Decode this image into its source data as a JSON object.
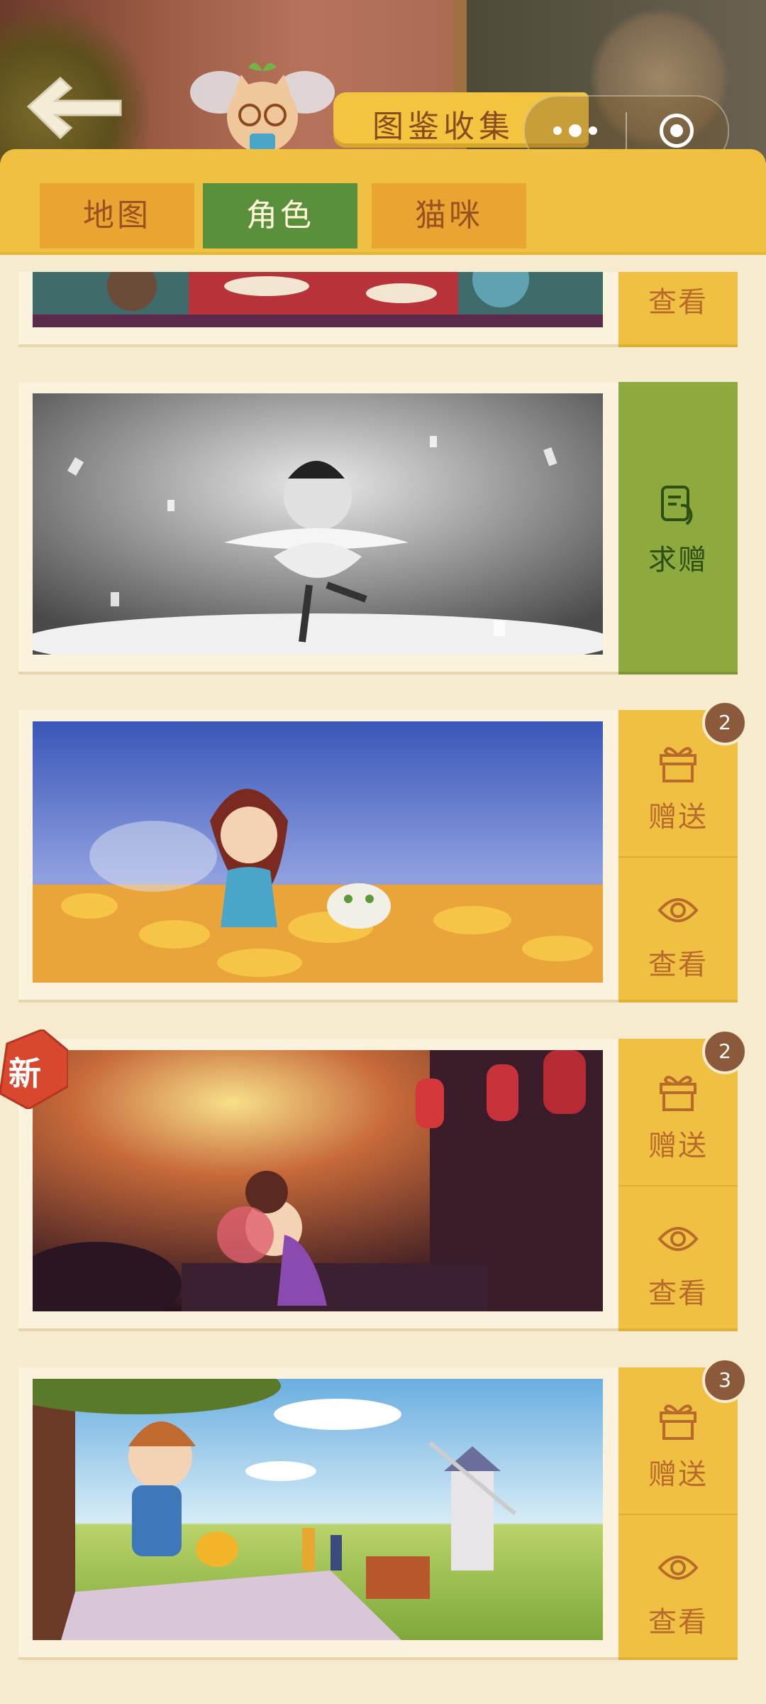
{
  "header": {
    "title": "图鉴收集"
  },
  "tabs": [
    {
      "label": "地图",
      "active": false
    },
    {
      "label": "角色",
      "active": true
    },
    {
      "label": "猫咪",
      "active": false
    }
  ],
  "cards": [
    {
      "id": "partial",
      "actions": [
        {
          "label": "查看",
          "icon": "eye-icon"
        }
      ]
    },
    {
      "id": "ballerina",
      "actions": [
        {
          "label": "求赠",
          "icon": "request-hand-icon"
        }
      ]
    },
    {
      "id": "fairy",
      "badge": "2",
      "actions": [
        {
          "label": "赠送",
          "icon": "gift-icon"
        },
        {
          "label": "查看",
          "icon": "eye-icon"
        }
      ]
    },
    {
      "id": "geisha",
      "badge": "2",
      "new_label": "新",
      "actions": [
        {
          "label": "赠送",
          "icon": "gift-icon"
        },
        {
          "label": "查看",
          "icon": "eye-icon"
        }
      ]
    },
    {
      "id": "picnic",
      "badge": "3",
      "actions": [
        {
          "label": "赠送",
          "icon": "gift-icon"
        },
        {
          "label": "查看",
          "icon": "eye-icon"
        }
      ]
    }
  ],
  "colors": {
    "accent": "#f0c043",
    "active_tab": "#5a8f3b",
    "label_brown": "#b86a2a",
    "request_green": "#8daa3e"
  }
}
